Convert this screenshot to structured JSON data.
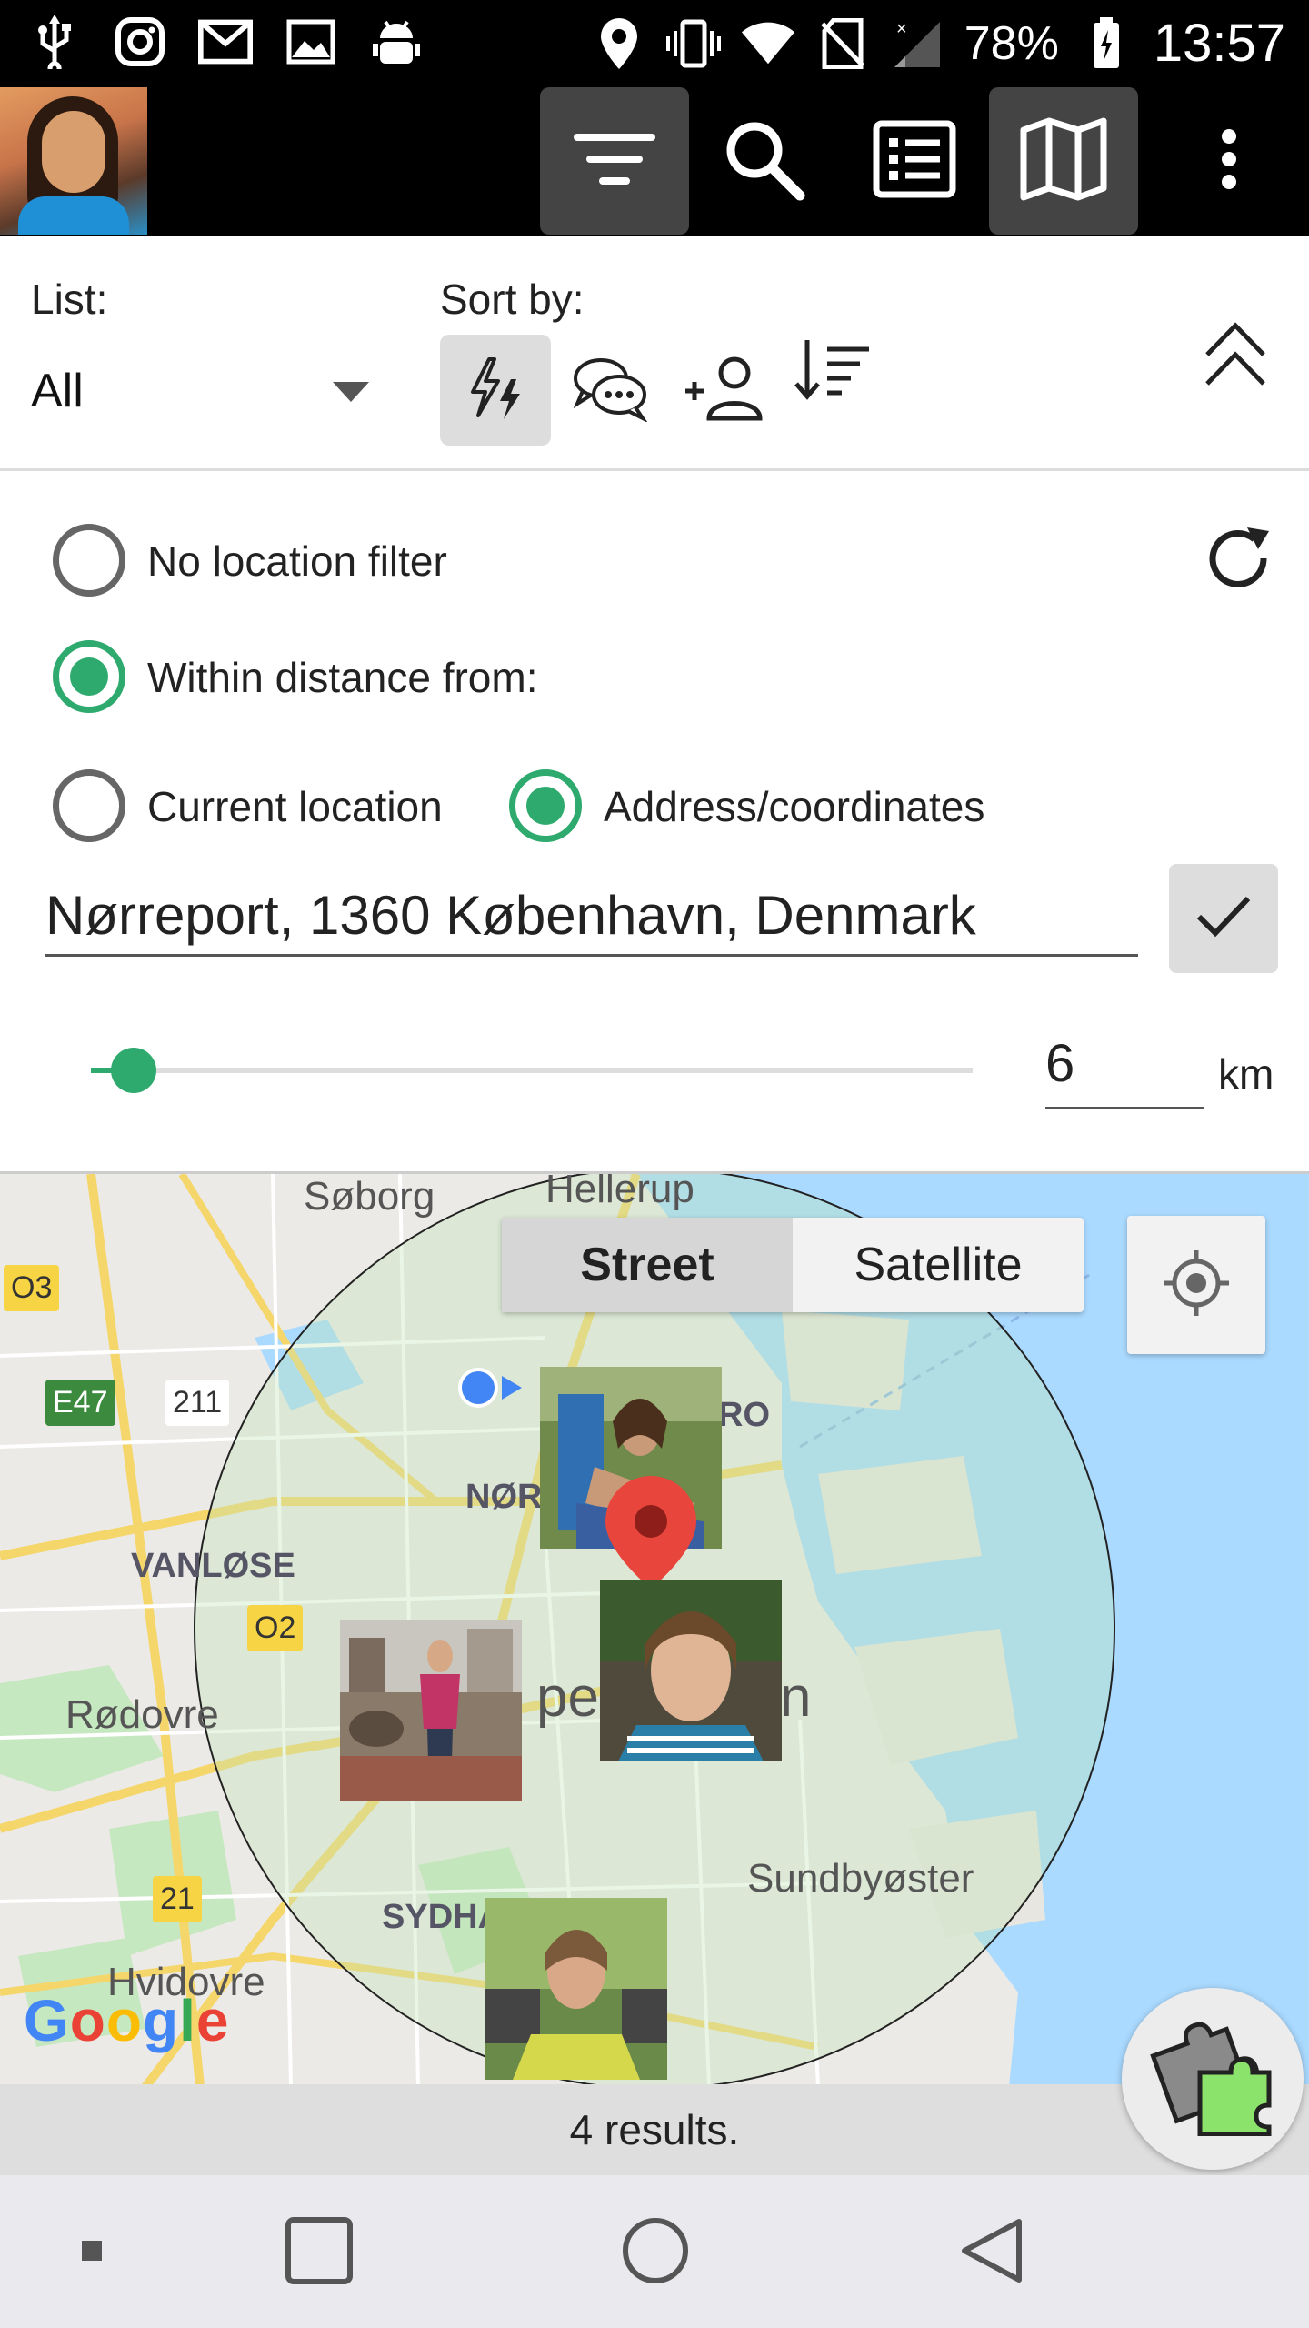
{
  "status_bar": {
    "battery": "78%",
    "time": "13:57",
    "left_icons": [
      "usb-icon",
      "instagram-icon",
      "mail-icon",
      "image-icon",
      "android-debug-icon"
    ],
    "right_icons": [
      "location-icon",
      "vibrate-icon",
      "wifi-icon",
      "no-sim-icon",
      "signal-icon",
      "battery-icon"
    ]
  },
  "toolbar": {
    "buttons": [
      "filter-button",
      "search-button",
      "list-view-button",
      "map-view-button",
      "overflow-menu-button"
    ],
    "active": [
      "filter-button",
      "map-view-button"
    ]
  },
  "filter": {
    "list_label": "List:",
    "list_value": "All",
    "sort_label": "Sort by:",
    "sort_options": [
      "activity-icon",
      "messages-icon",
      "add-contact-icon",
      "sort-order-icon"
    ],
    "selected_sort": "activity-icon"
  },
  "location": {
    "no_filter_label": "No location filter",
    "within_distance_label": "Within distance from:",
    "current_location_label": "Current location",
    "address_label": "Address/coordinates",
    "selected_mode": "within_distance",
    "selected_source": "address",
    "address_value": "Nørreport, 1360 København, Denmark",
    "distance_value": "6",
    "distance_unit": "km",
    "slider_fraction": 0.05
  },
  "map": {
    "type_street": "Street",
    "type_satellite": "Satellite",
    "selected_type": "Street",
    "places": {
      "soborg": "Søborg",
      "hellerup": "Hellerup",
      "norr": "NØR",
      "ro": "RO",
      "vanlose": "VANLØSE",
      "rodovre": "Rødovre",
      "kobenhavn_a": "pe",
      "kobenhavn_b": "n",
      "sundbyoster": "Sundbyøster",
      "sydha": "SYDHA",
      "hvidovre": "Hvidovre"
    },
    "road_badges": {
      "o3": "O3",
      "e47": "E47",
      "r211": "211",
      "o2": "O2",
      "r21": "21"
    },
    "attribution": "Google"
  },
  "results": {
    "text": "4 results."
  }
}
